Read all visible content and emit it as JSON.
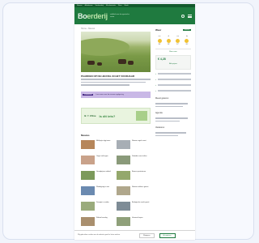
{
  "topbar": {
    "links": [
      "Nieuws",
      "Akkerbouw",
      "Veehouderij",
      "Mechanisatie",
      "Weer",
      "Markt"
    ]
  },
  "header": {
    "logo_prefix": "Bo",
    "logo_rest": "erderij",
    "tagline": "vakblad voor de agrarische sector"
  },
  "breadcrumb": "Home › Nieuws",
  "hero": {
    "caption": "PAARDEN OP DE HEUVEL IN HET VOORJAAR"
  },
  "banner": {
    "tag": "PREMIUM",
    "text": "Lees meer over de nieuwe regelgeving"
  },
  "ad": {
    "brand": "Ik ☀ ZOne",
    "slogan": "Is dit iets?"
  },
  "news": {
    "section_title": "Nieuws",
    "items": [
      "Melkprijs stijgt weer",
      "Nieuwe regels mest",
      "Oogst valt tegen",
      "Subsidie voor stallen",
      "Grondprijzen stabiel",
      "Boeren protesteren",
      "Weidegang in mei",
      "Nieuwe trekkers getest",
      "Droogte in zuiden",
      "Biologische markt groeit",
      "Stikstof overleg",
      "Veemarkt open"
    ]
  },
  "weather": {
    "title": "Weer",
    "location": "Utrecht",
    "days": [
      {
        "d": "ma",
        "t": "18°"
      },
      {
        "d": "di",
        "t": "19°"
      },
      {
        "d": "wo",
        "t": "17°"
      },
      {
        "d": "do",
        "t": "20°"
      }
    ],
    "link": "Meer weer"
  },
  "prices": {
    "value": "€ 4,28",
    "link": "Alle prijzen"
  },
  "side_heads": [
    "Meest gelezen",
    "Agenda",
    "Vacatures"
  ],
  "cookie": {
    "text": "Wij gebruiken cookies om de website goed te laten werken.",
    "decline": "Weigeren",
    "accept": "Accepteren"
  },
  "colors": {
    "brand": "#1f7a3f",
    "dark_brand": "#13592d",
    "banner": "#c9b8e6"
  }
}
